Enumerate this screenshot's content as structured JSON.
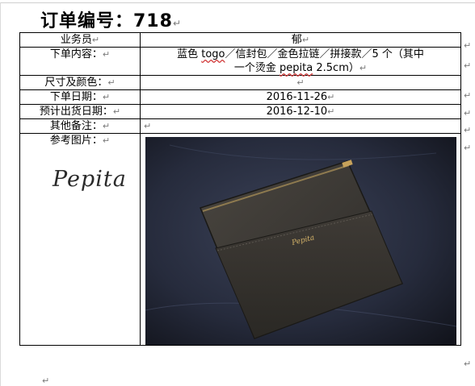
{
  "title": "订单编号：718",
  "para_mark": "↵",
  "rows": [
    {
      "label": "业务员",
      "value": "郁"
    },
    {
      "label": "下单内容：",
      "value_line1_pre": "蓝色 ",
      "value_line1_brand": "togo",
      "value_line1_post": "／信封包／金色拉链／拼接款／5 个（其中",
      "value_line2_pre": "一个烫金 ",
      "value_line2_brand": "pepita",
      "value_line2_post": " 2.5cm）"
    },
    {
      "label": "尺寸及颜色：",
      "value": ""
    },
    {
      "label": "下单日期：",
      "value": "2016-11-26"
    },
    {
      "label": "预计出货日期：",
      "value": "2016-12-10"
    },
    {
      "label": "其他备注：",
      "value": ""
    },
    {
      "label": "参考图片：",
      "signature": "Pepita",
      "stamp": "Pepita"
    }
  ],
  "colors": {
    "bag": "#3a3733",
    "background": "#2d3348",
    "stamp_gold": "#d8b66a"
  },
  "icons": {
    "paragraph_mark": "return-arrow-icon"
  }
}
